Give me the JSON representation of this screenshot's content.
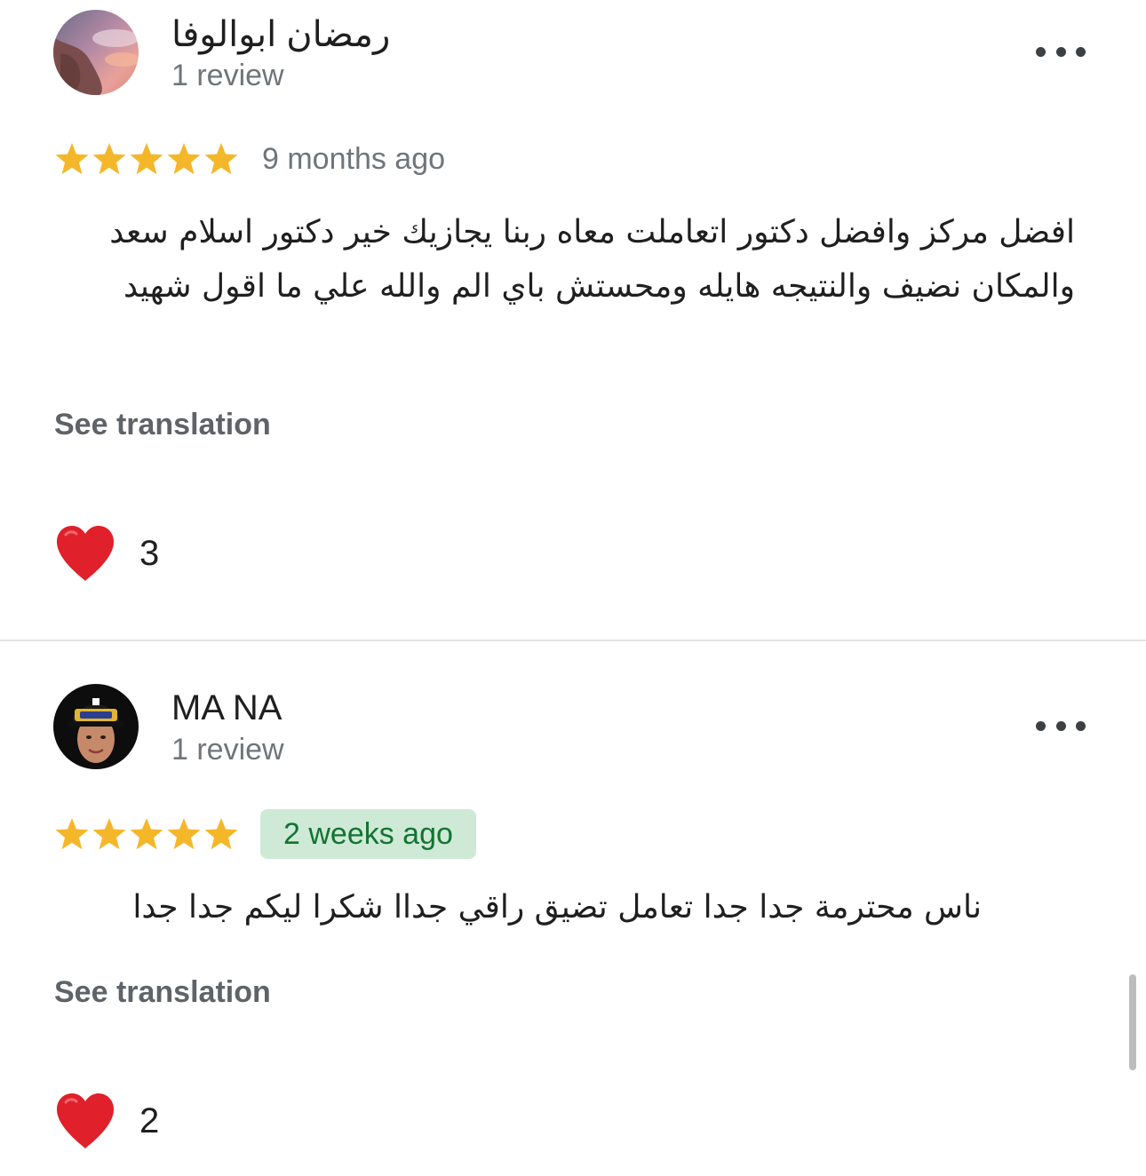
{
  "colors": {
    "star": "#f5b72a",
    "heart": "#e0202a",
    "badge_bg": "#ceead6",
    "badge_text": "#137333",
    "meta_text": "#70757a"
  },
  "reviews": [
    {
      "author_name": "رمضان ابوالوفا",
      "author_meta": "1 review",
      "avatar_icon": "avatar-photo-sunset",
      "rating": 5,
      "time": "9 months ago",
      "time_highlighted": false,
      "text": "افضل مركز وافضل دكتور اتعاملت معاه ربنا يجازيك خير دكتور اسلام سعد والمكان نضيف والنتيجه هايله ومحستش باي الم والله علي ما اقول شهيد",
      "translate_label": "See translation",
      "reaction_icon": "heart-icon",
      "reaction_count": "3",
      "more_icon": "more-options-icon"
    },
    {
      "author_name": "MA NA",
      "author_meta": "1 review",
      "avatar_icon": "avatar-photo-boy-cap",
      "rating": 5,
      "time": "2 weeks ago",
      "time_highlighted": true,
      "text": "ناس محترمة جدا جدا تعامل تضيق راقي جداا شكرا ليكم جدا جدا",
      "translate_label": "See translation",
      "reaction_icon": "heart-icon",
      "reaction_count": "2",
      "more_icon": "more-options-icon"
    }
  ]
}
